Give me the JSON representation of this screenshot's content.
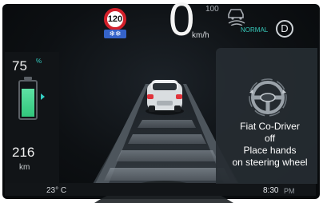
{
  "speed": {
    "value": "0",
    "unit": "km/h",
    "limit_sign": "120",
    "snow_badge": "❄❄"
  },
  "acc": {
    "set_speed": "100",
    "icon": "adaptive-cruise-icon"
  },
  "drive": {
    "mode": "NORMAL",
    "gear": "D"
  },
  "battery": {
    "percent": "75",
    "percent_sign": "%",
    "level": 0.75,
    "icon": "battery-icon"
  },
  "range": {
    "value": "216",
    "unit": "km"
  },
  "status": {
    "temperature": "23° C",
    "time": "8:30",
    "time_suffix": "PM"
  },
  "alert": {
    "icon": "steering-wheel-icon",
    "line1": "Fiat Co-Driver",
    "line2": "off",
    "line3": "Place hands",
    "line4": "on steering wheel"
  },
  "colors": {
    "accent_teal": "#34d0c4",
    "speed_sign_red": "#d3202a",
    "snow_blue": "#3563c9",
    "battery_green": "#32c67c"
  }
}
